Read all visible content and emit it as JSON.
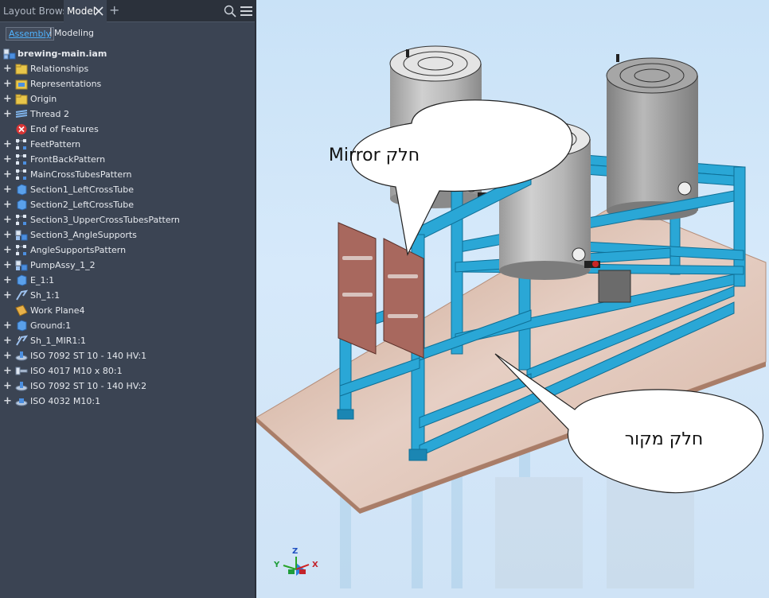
{
  "browser": {
    "tabs": [
      "Layout Browser",
      "Model"
    ],
    "modes": {
      "assembly": "Assembly",
      "modeling": "Modeling",
      "separator": "|"
    },
    "root": "brewing-main.iam",
    "items": [
      {
        "label": "Relationships",
        "icon": "folder-icon"
      },
      {
        "label": "Representations",
        "icon": "representations-icon"
      },
      {
        "label": "Origin",
        "icon": "folder-icon"
      },
      {
        "label": "Thread 2",
        "icon": "thread-icon"
      },
      {
        "label": "End of Features",
        "icon": "end-of-features-icon"
      },
      {
        "label": "FeetPattern",
        "icon": "pattern-icon"
      },
      {
        "label": "FrontBackPattern",
        "icon": "pattern-icon"
      },
      {
        "label": "MainCrossTubesPattern",
        "icon": "pattern-icon"
      },
      {
        "label": "Section1_LeftCrossTube",
        "icon": "part-icon"
      },
      {
        "label": "Section2_LeftCrossTube",
        "icon": "part-icon"
      },
      {
        "label": "Section3_UpperCrossTubesPattern",
        "icon": "pattern-icon"
      },
      {
        "label": "Section3_AngleSupports",
        "icon": "subassembly-icon"
      },
      {
        "label": "AngleSupportsPattern",
        "icon": "pattern-icon"
      },
      {
        "label": "PumpAssy_1_2",
        "icon": "subassembly-icon"
      },
      {
        "label": "E_1:1",
        "icon": "part-icon"
      },
      {
        "label": "Sh_1:1",
        "icon": "sheetmetal-icon"
      },
      {
        "label": "Work Plane4",
        "icon": "work-plane-icon"
      },
      {
        "label": "Ground:1",
        "icon": "part-icon"
      },
      {
        "label": "Sh_1_MIR1:1",
        "icon": "mirror-part-icon"
      },
      {
        "label": "ISO 7092 ST 10 - 140 HV:1",
        "icon": "washer-icon"
      },
      {
        "label": "ISO 4017 M10 x 80:1",
        "icon": "bolt-icon"
      },
      {
        "label": "ISO 7092 ST 10 - 140 HV:2",
        "icon": "washer-icon"
      },
      {
        "label": "ISO 4032 M10:1",
        "icon": "nut-icon"
      }
    ]
  },
  "callouts": {
    "mirror": "חלק Mirror",
    "source": "חלק מקור"
  },
  "axes": {
    "x": "X",
    "y": "Y",
    "z": "Z"
  },
  "colors": {
    "frame": "#2aa7d6",
    "panel_red": "#a8685e",
    "floor": "#d9b9a8",
    "tank": "#b8b8b8"
  }
}
